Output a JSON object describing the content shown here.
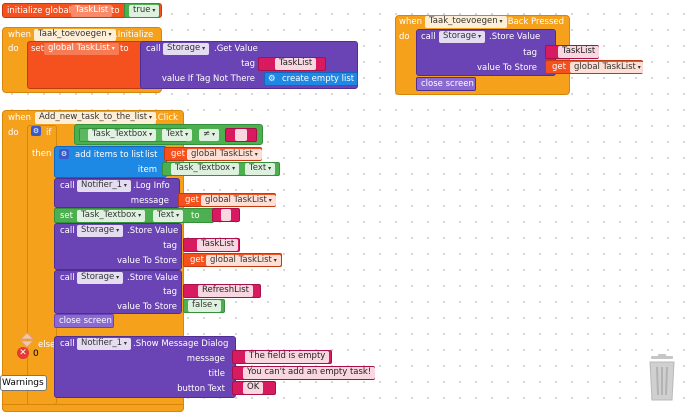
{
  "init_block": {
    "keyword": "initialize global",
    "var_name": "TaskList",
    "to": "to",
    "value": "true"
  },
  "initialize_block": {
    "when": "when",
    "component": "Taak_toevoegen",
    "event": ".Initialize",
    "do": "do",
    "set": "set",
    "var": "global TaskList",
    "to": "to",
    "call": "call",
    "storage": "Storage",
    "method": ".Get Value",
    "tag_label": "tag",
    "tag_value": "TaskList",
    "not_there_label": "value If Tag Not There",
    "create_list": "create empty list"
  },
  "back_block": {
    "when": "when",
    "component": "Taak_toevoegen",
    "event": ".Back Pressed",
    "do": "do",
    "call": "call",
    "storage": "Storage",
    "method": ".Store Value",
    "tag_label": "tag",
    "tag_value": "TaskList",
    "store_label": "value To Store",
    "get": "get",
    "var": "global TaskList",
    "close": "close screen"
  },
  "click_block": {
    "when": "when",
    "component": "Add_new_task_to_the_list",
    "event": ".Click",
    "do": "do",
    "if": "if",
    "textbox": "Task_Textbox",
    "text_prop": "Text",
    "neq": "≠",
    "then": "then",
    "add_items": "add items to list",
    "list_label": "list",
    "get": "get",
    "var": "global TaskList",
    "item_label": "item",
    "call": "call",
    "notifier": "Notifier_1",
    "log_info": ".Log Info",
    "message_label": "message",
    "set": "set",
    "to": "to",
    "storage": "Storage",
    "store_value": ".Store Value",
    "tag_label": "tag",
    "tag_tasklist": "TaskList",
    "store_label": "value To Store",
    "tag_refresh": "RefreshList",
    "false_val": "false",
    "close": "close screen",
    "else": "else",
    "show_dialog": ".Show Message Dialog",
    "title_label": "title",
    "button_label": "button Text",
    "msg_empty": "The field is empty",
    "title_empty": "You can't add an empty task!",
    "ok": "OK"
  },
  "status": {
    "warning_count": "0",
    "warnings_button": "Warnings"
  },
  "colors": {
    "event": "#f6a11c",
    "procedure": "#6a44b4",
    "variable": "#f4511e",
    "text": "#d81b60",
    "logic": "#4caf50",
    "list": "#1e88e5"
  }
}
